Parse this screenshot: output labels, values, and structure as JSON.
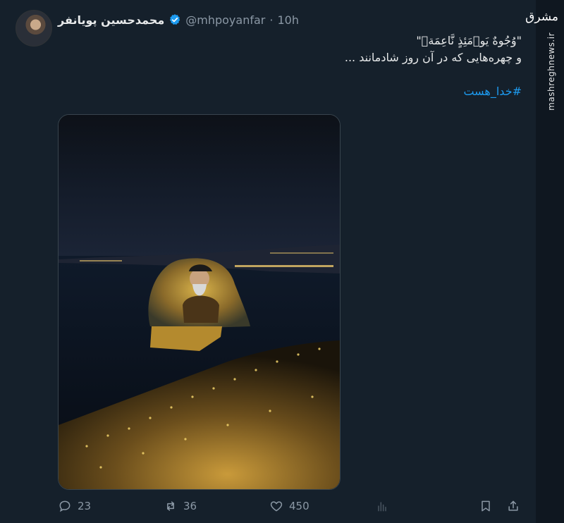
{
  "author": {
    "name": "محمدحسین پویانفر",
    "handle": "@mhpoyanfar",
    "separator": "·",
    "time": "10h"
  },
  "tweet": {
    "line1": "\"وُجُوهٌ يَوۡمَئِذٍ نَّاعِمَةٞ\"",
    "line2": "و چهره‌هایی که در آن روز شادمانند ...",
    "hashtag": "#خدا_هست"
  },
  "media": {
    "description_icon": "photo"
  },
  "actions": {
    "replies": "23",
    "retweets": "36",
    "likes": "450"
  },
  "watermark": {
    "logo": "مشرق",
    "site": "mashreghnews.ir"
  },
  "colors": {
    "background": "#15202b",
    "accent": "#1d9bf0",
    "muted": "#8b98a5"
  }
}
